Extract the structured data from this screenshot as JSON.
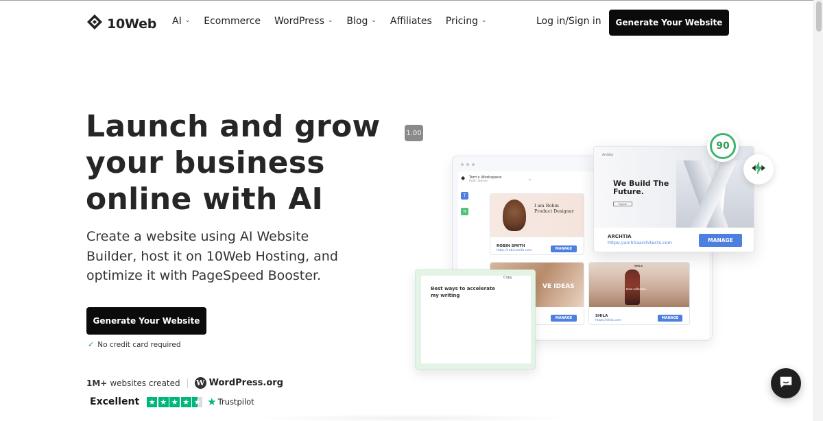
{
  "header": {
    "logo_text": "10Web",
    "nav": [
      {
        "label": "AI",
        "has_dropdown": true
      },
      {
        "label": "Ecommerce",
        "has_dropdown": false
      },
      {
        "label": "WordPress",
        "has_dropdown": true
      },
      {
        "label": "Blog",
        "has_dropdown": true
      },
      {
        "label": "Affiliates",
        "has_dropdown": false
      },
      {
        "label": "Pricing",
        "has_dropdown": true
      }
    ],
    "login_label": "Log in/Sign in",
    "cta_label": "Generate Your Website"
  },
  "hero": {
    "title_lines": [
      "Launch and grow",
      "your business",
      "online with AI"
    ],
    "subtitle": "Create a website using AI Website Builder, host it on 10Web Hosting, and optimize it with PageSpeed Booster.",
    "cta_label": "Generate Your Website",
    "no_credit_card": "No credit card required",
    "websites_count": "1M+",
    "websites_label": "websites created",
    "wordpress_label": "WordPress.org",
    "rating_word": "Excellent",
    "rating_stars": 4.5,
    "trustpilot_label": "Trustpilot"
  },
  "illustration": {
    "zoom_badge": "1.00",
    "workspace_name": "Tom's Workspace",
    "workspace_role": "Role: Owner",
    "side_tabs": [
      "T",
      "N"
    ],
    "pagespeed_score": "90",
    "featured_site": {
      "brand": "Archtia",
      "headline_lines": [
        "We Build The",
        "Future."
      ],
      "button": "Explore",
      "name": "ARCHTIA",
      "url": "https://archtiaarchitects.com",
      "manage": "MANAGE"
    },
    "sites": [
      {
        "name": "ROBIN SMITH",
        "url": "https://robinsmith.com",
        "manage": "MANAGE",
        "headline_lines": [
          "I am Robin",
          "Product Designer"
        ]
      },
      {
        "name": "",
        "url": "",
        "manage": "MANAGE",
        "headline": "VE IDEAS"
      },
      {
        "name": "SHILA",
        "url": "https://shila.com",
        "manage": "MANAGE",
        "headline": "New collection",
        "brand": "SHILA"
      }
    ],
    "ai_writer": {
      "copy_label": "Copy",
      "text": "Best ways to accelerate my writing"
    }
  },
  "colors": {
    "primary_dark": "#0b0b0b",
    "accent_blue": "#4d7fe0",
    "accent_green": "#3db46d",
    "trustpilot_green": "#00b67a"
  },
  "icons": {
    "logo": "10web-diamond-icon",
    "dropdown": "chevron-down-icon",
    "check": "check-icon",
    "wordpress": "wordpress-icon",
    "star": "star-icon",
    "bolt": "lightning-icon",
    "chat": "chat-icon"
  }
}
